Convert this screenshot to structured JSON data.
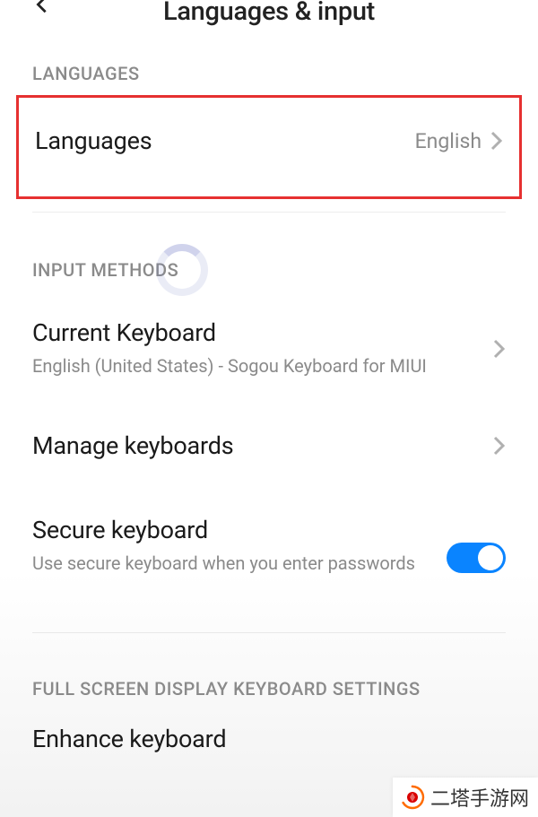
{
  "header": {
    "title": "Languages & input"
  },
  "sections": {
    "languages": {
      "header": "LANGUAGES",
      "row": {
        "title": "Languages",
        "value": "English"
      }
    },
    "input_methods": {
      "header": "INPUT METHODS",
      "current_keyboard": {
        "title": "Current Keyboard",
        "subtitle": "English (United States) - Sogou Keyboard for MIUI"
      },
      "manage_keyboards": {
        "title": "Manage keyboards"
      },
      "secure_keyboard": {
        "title": "Secure keyboard",
        "subtitle": "Use secure keyboard when you enter passwords",
        "toggle_on": true
      }
    },
    "fullscreen": {
      "header": "FULL SCREEN DISPLAY KEYBOARD SETTINGS",
      "enhance": {
        "title": "Enhance keyboard"
      }
    }
  },
  "watermark": {
    "text": "二塔手游网"
  }
}
